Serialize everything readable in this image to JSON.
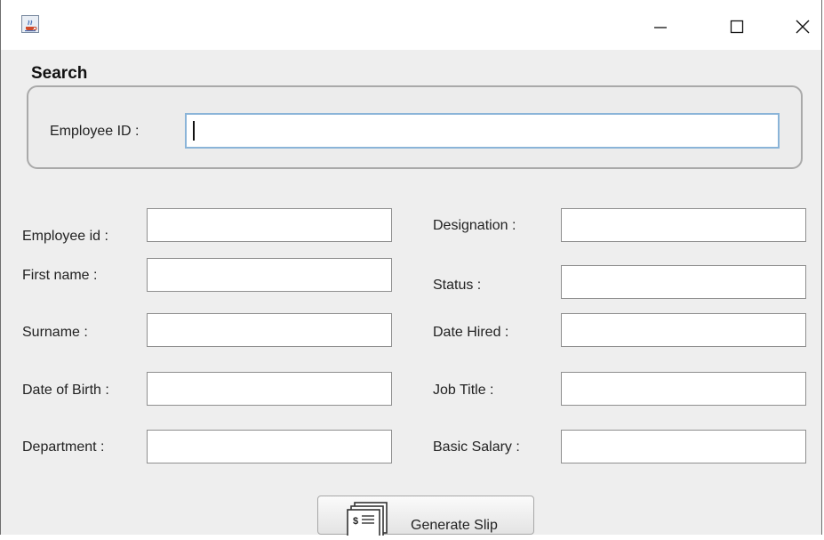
{
  "window": {
    "icon": "java-coffee-cup-icon",
    "controls": {
      "minimize_icon": "minimize-icon",
      "maximize_icon": "maximize-icon",
      "close_icon": "close-icon"
    }
  },
  "search": {
    "title": "Search",
    "employee_id_label": "Employee ID :",
    "employee_id_value": ""
  },
  "form": {
    "left": [
      {
        "label": "Employee id :",
        "value": ""
      },
      {
        "label": "First name :",
        "value": ""
      },
      {
        "label": "Surname :",
        "value": ""
      },
      {
        "label": "Date of Birth :",
        "value": ""
      },
      {
        "label": "Department :",
        "value": ""
      }
    ],
    "right": [
      {
        "label": "Designation :",
        "value": ""
      },
      {
        "label": "Status :",
        "value": ""
      },
      {
        "label": "Date Hired :",
        "value": ""
      },
      {
        "label": "Job Title :",
        "value": ""
      },
      {
        "label": "Basic Salary :",
        "value": ""
      }
    ]
  },
  "actions": {
    "generate_slip_label": "Generate Slip",
    "generate_slip_icon": "payslip-icon"
  },
  "colors": {
    "focus_border": "#8ab4d8",
    "panel_bg": "#eeeeee"
  }
}
